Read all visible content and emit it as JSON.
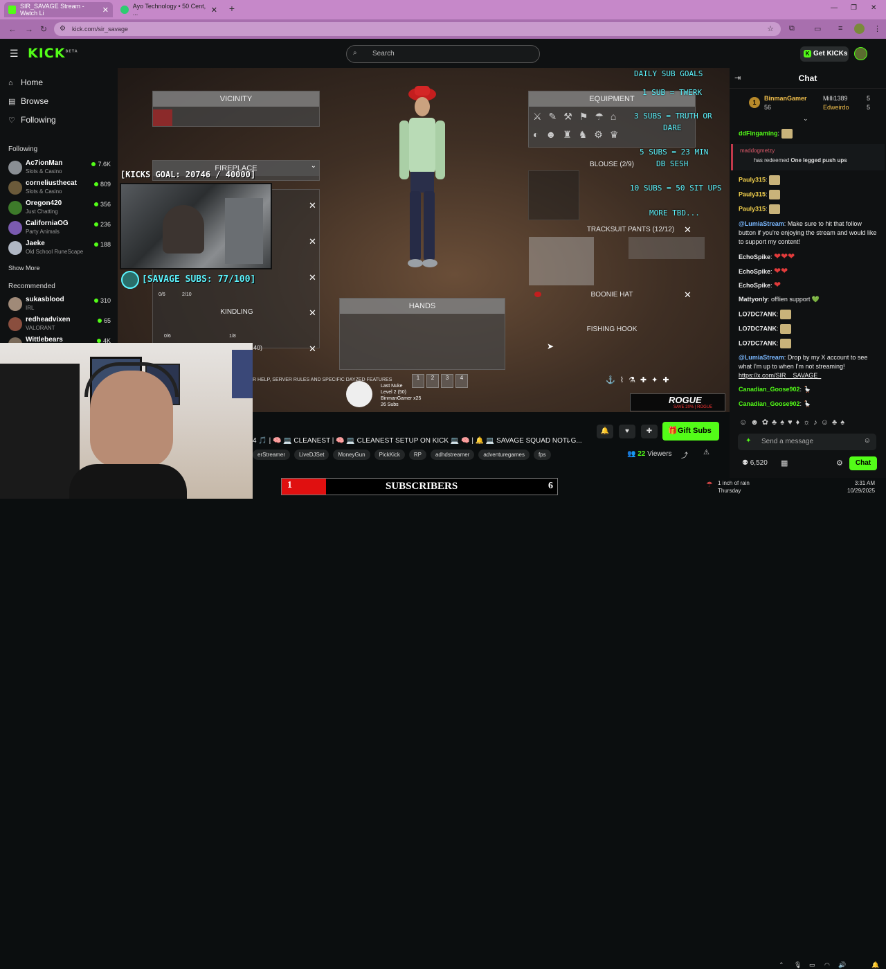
{
  "browser": {
    "tabs": [
      {
        "title": "SIR_SAVAGE Stream - Watch Li",
        "favicon_color": "#53fc18"
      },
      {
        "title": "Ayo Technology • 50 Cent, ...",
        "favicon_color": "#2ecc71"
      }
    ],
    "url": "kick.com/sir_savage",
    "window_controls": [
      "—",
      "❐",
      "✕"
    ]
  },
  "header": {
    "logo": "KICK",
    "logo_sup": "BETA",
    "search_placeholder": "Search",
    "get_kicks": "Get KICKs"
  },
  "sidebar": {
    "nav": [
      {
        "label": "Home",
        "icon": "home-icon"
      },
      {
        "label": "Browse",
        "icon": "browse-icon"
      },
      {
        "label": "Following",
        "icon": "heart-icon"
      }
    ],
    "following_title": "Following",
    "following": [
      {
        "name": "Ac7ionMan",
        "game": "Slots & Casino",
        "viewers": "7.6K",
        "color": "#8a8f94"
      },
      {
        "name": "corneliusthecat",
        "game": "Slots & Casino",
        "viewers": "809",
        "color": "#6b5a3a"
      },
      {
        "name": "Oregon420",
        "game": "Just Chatting",
        "viewers": "356",
        "color": "#3d7a2a"
      },
      {
        "name": "CaliforniaOG",
        "game": "Party Animals",
        "viewers": "236",
        "color": "#7a5ab0"
      },
      {
        "name": "Jaeke",
        "game": "Old School RuneScape",
        "viewers": "188",
        "color": "#b0b7c3"
      }
    ],
    "show_more": "Show More",
    "recommended_title": "Recommended",
    "recommended": [
      {
        "name": "sukasblood",
        "game": "IRL",
        "viewers": "310",
        "color": "#a08a78"
      },
      {
        "name": "redheadvixen",
        "game": "VALORANT",
        "viewers": "65",
        "color": "#8a4e3e"
      },
      {
        "name": "Wittlebears",
        "game": "",
        "viewers": "4K",
        "color": "#7a6a5a"
      }
    ]
  },
  "stream": {
    "panels": {
      "vicinity": "VICINITY",
      "fireplace": "FIREPLACE",
      "kindling": "KINDLING",
      "hands": "HANDS",
      "equipment": "EQUIPMENT",
      "blouse": "BLOUSE (2/9)",
      "tracksuit": "TRACKSUIT PANTS (12/12)",
      "boonie": "BOONIE HAT",
      "fishing": "FISHING HOOK",
      "slot_counts": [
        "0/6",
        "2/10",
        "0/6",
        "1/8"
      ],
      "partial_label": "40)"
    },
    "goals": [
      "DAILY SUB GOALS",
      "1 SUB = TWERK",
      "3 SUBS = TRUTH OR",
      "DARE",
      "5 SUBS = 23 MIN",
      "DB SESH",
      "10 SUBS = 50 SIT UPS",
      "MORE TBD..."
    ],
    "kicks_goal": "[KICKS GOAL: 20746 / 40000]",
    "savage_subs": "[SAVAGE SUBS: 77/100]",
    "footer_help": "R HELP, SERVER RULES AND SPECIFIC DAYZED FEATURES",
    "hotbar": [
      "1",
      "2",
      "3",
      "4"
    ],
    "last_nuke": [
      "Last Nuke",
      "Level 2 (50)",
      "BinmanGamer x25",
      "26 Subs"
    ],
    "rogue": {
      "brand": "ROGUE",
      "promo": "SAVE 20% | ROGUE"
    }
  },
  "controls": {
    "title": "4 🎵 | 🧠 💻 CLEANEST | 🧠 💻 CLEANEST SETUP ON KICK 💻 🧠 | 🔔 💻 SAVAGE SQUAD NOTI G...",
    "tags": [
      "erStreamer",
      "LiveDJSet",
      "MoneyGun",
      "PickKick",
      "RP",
      "adhdstreamer",
      "adventuregames",
      "fps"
    ],
    "gift_subs": "Gift Subs",
    "viewers": "22",
    "viewers_label": "Viewers"
  },
  "chat": {
    "title": "Chat",
    "leaderboard": [
      {
        "rank": "1",
        "name": "BinmanGamer",
        "count": "56"
      },
      {
        "name": "Milli1389",
        "count": "5"
      },
      {
        "name": "Edweirdo",
        "count": "5"
      }
    ],
    "redeem_user": "maddogmetzy",
    "redeem_text": "has redeemed",
    "redeem_item": "One legged push ups",
    "messages": [
      {
        "user": "ddFingaming",
        "color": "#53fc18",
        "text": ""
      },
      {
        "user": "Pauly315",
        "color": "#f2d04c",
        "text": ""
      },
      {
        "user": "Pauly315",
        "color": "#f2d04c",
        "text": ""
      },
      {
        "user": "Pauly315",
        "color": "#f2d04c",
        "text": ""
      },
      {
        "user": "@LumiaStream",
        "color": "#7ab8ff",
        "text": "Make sure to hit that follow button if you're enjoying the stream and would like to support my content!"
      },
      {
        "user": "EchoSpike",
        "color": "#ffffff",
        "text": ""
      },
      {
        "user": "EchoSpike",
        "color": "#ffffff",
        "text": ""
      },
      {
        "user": "EchoSpike",
        "color": "#ffffff",
        "text": ""
      },
      {
        "user": "Mattyonly",
        "color": "#ffffff",
        "text": "offlien support 💚"
      },
      {
        "user": "LO7DC7ANK",
        "color": "#ffffff",
        "text": ""
      },
      {
        "user": "LO7DC7ANK",
        "color": "#ffffff",
        "text": ""
      },
      {
        "user": "LO7DC7ANK",
        "color": "#ffffff",
        "text": ""
      },
      {
        "user": "@LumiaStream",
        "color": "#7ab8ff",
        "text": "Drop by my X account to see what I'm up to when I'm not streaming!"
      },
      {
        "user": "",
        "color": "#ffffff",
        "text": "https://x.com/SIR__SAVAGE_"
      },
      {
        "user": "Canadian_Goose902",
        "color": "#53fc18",
        "text": ""
      },
      {
        "user": "Canadian_Goose902",
        "color": "#53fc18",
        "text": ""
      }
    ],
    "input_placeholder": "Send a message",
    "points": "6,520",
    "send": "Chat"
  },
  "overlay_bar": {
    "left": "1",
    "label": "SUBSCRIBERS",
    "right": "6"
  },
  "taskbar": {
    "weather_line1": "1 inch of rain",
    "weather_line2": "Thursday",
    "time": "3:31 AM",
    "date": "10/29/2025"
  }
}
